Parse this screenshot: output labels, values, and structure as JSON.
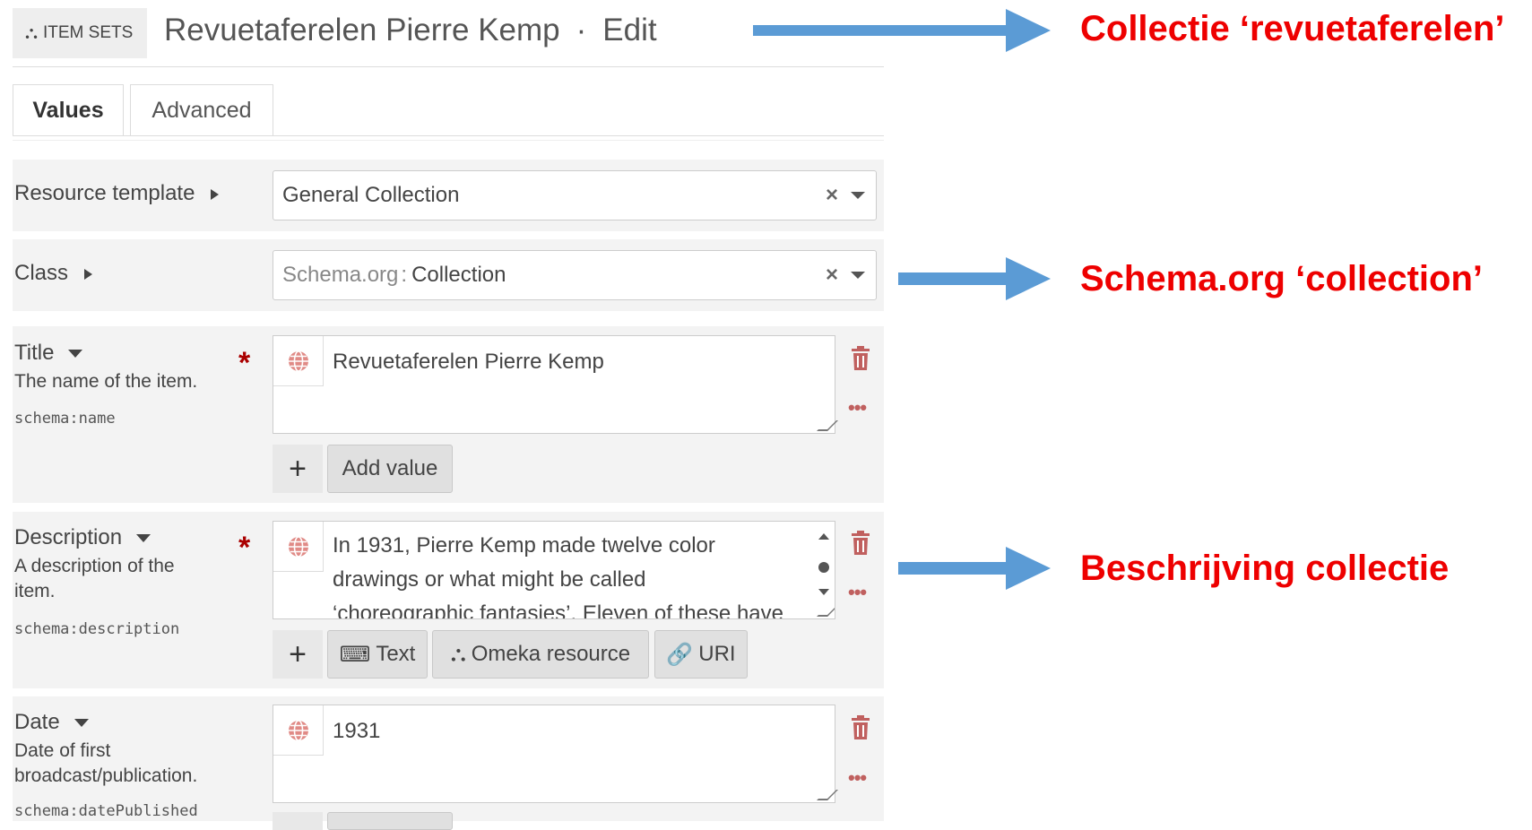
{
  "header": {
    "badge_label": "ITEM SETS",
    "title": "Revuetaferelen Pierre Kemp",
    "separator": "·",
    "action": "Edit"
  },
  "tabs": [
    {
      "label": "Values",
      "active": true
    },
    {
      "label": "Advanced",
      "active": false
    }
  ],
  "resource_template": {
    "label": "Resource template",
    "value": "General Collection"
  },
  "class": {
    "label": "Class",
    "prefix": "Schema.org",
    "colon": ":",
    "value": "Collection"
  },
  "title_field": {
    "label": "Title",
    "description": "The name of the item.",
    "term": "schema:name",
    "required_mark": "*",
    "value": "Revuetaferelen Pierre Kemp",
    "add_value": "Add value"
  },
  "description_field": {
    "label": "Description",
    "description": "A description of the item.",
    "term": "schema:description",
    "required_mark": "*",
    "value_lines": [
      "In 1931, Pierre Kemp made twelve color",
      "drawings or what might be called",
      "‘choreographic fantasies’. Eleven of these have"
    ],
    "buttons": {
      "text": "Text",
      "omeka": "Omeka resource",
      "uri": "URI"
    }
  },
  "date_field": {
    "label": "Date",
    "description_line1": "Date of first",
    "description_line2": "broadcast/publication.",
    "term": "schema:datePublished",
    "value": "1931"
  },
  "annotations": {
    "a1": "Collectie ‘revuetaferelen’",
    "a2": "Schema.org ‘collection’",
    "a3": "Beschrijving collectie"
  },
  "colors": {
    "annotation_text": "#ee0000",
    "arrow": "#5b9bd5",
    "danger_icon": "#c0605f"
  }
}
